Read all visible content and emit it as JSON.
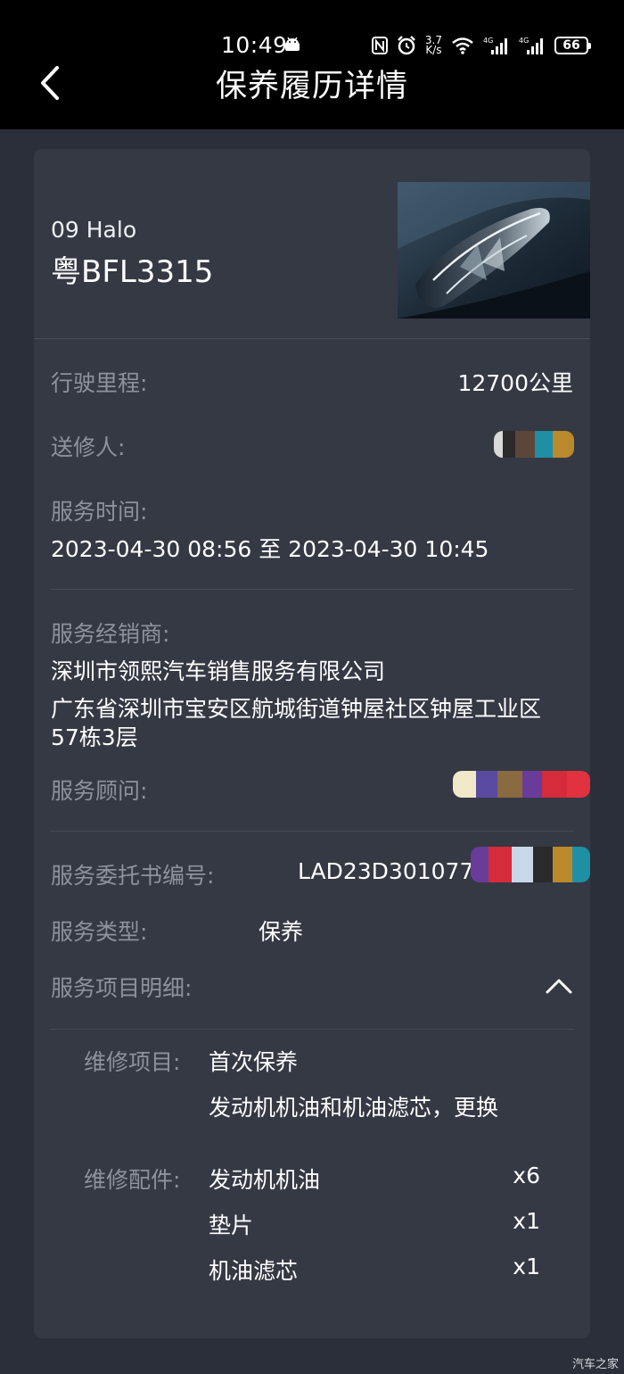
{
  "status_bar": {
    "time": "10:49",
    "net_speed_top": "3.7",
    "net_speed_bottom": "K/s",
    "battery": "66",
    "icons": [
      "android-icon",
      "nfc-icon",
      "alarm-icon",
      "wifi-icon",
      "signal-icon",
      "signal-icon",
      "battery-icon"
    ]
  },
  "header": {
    "title": "保养履历详情",
    "back_icon": "chevron-left-icon"
  },
  "vehicle": {
    "model": "09 Halo",
    "plate": "粤BFL3315"
  },
  "details": {
    "mileage_label": "行驶里程:",
    "mileage_value": "12700公里",
    "sender_label": "送修人:",
    "service_time_label": "服务时间:",
    "service_time_value": "2023-04-30 08:56 至 2023-04-30 10:45",
    "dealer_label": "服务经销商:",
    "dealer_name": "深圳市领熙汽车销售服务有限公司",
    "dealer_address_line1": "广东省深圳市宝安区航城街道钟屋社区钟屋工业区",
    "dealer_address_line2": "57栋3层",
    "advisor_label": "服务顾问:",
    "order_no_label": "服务委托书编号:",
    "order_no_value": "LAD23D301077",
    "service_type_label": "服务类型:",
    "service_type_value": "保养",
    "items_label": "服务项目明细:",
    "items_toggle_icon": "chevron-up-icon"
  },
  "items_detail": {
    "repair_items_label": "维修项目:",
    "repair_items": [
      "首次保养",
      "发动机机油和机油滤芯，更换"
    ],
    "parts_label": "维修配件:",
    "parts": [
      {
        "name": "发动机机油",
        "qty": "x6"
      },
      {
        "name": "垫片",
        "qty": "x1"
      },
      {
        "name": "机油滤芯",
        "qty": "x1"
      }
    ]
  },
  "watermark": "汽车之家",
  "colors": {
    "background": "#2b2f39",
    "card": "#353944",
    "label": "#8e929b",
    "topbar": "#000000"
  }
}
